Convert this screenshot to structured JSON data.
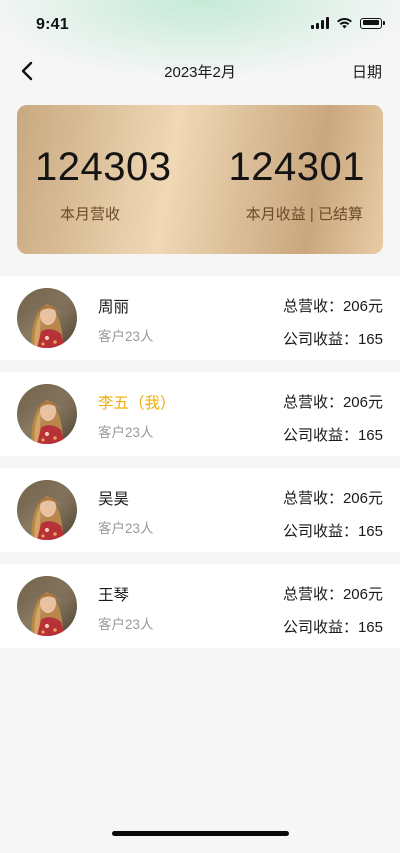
{
  "status_bar": {
    "time": "9:41",
    "icons": [
      "signal-icon",
      "wifi-icon",
      "battery-icon"
    ]
  },
  "nav": {
    "back_icon": "chevron-left-icon",
    "title": "2023年2月",
    "action_label": "日期"
  },
  "summary": {
    "left_value": "124303",
    "left_label": "本月营收",
    "right_value": "124301",
    "right_label": "本月收益 | 已结算"
  },
  "members": [
    {
      "name": "周丽",
      "customers": "客户23人",
      "revenue": "总营收：206元",
      "income": "公司收益：165",
      "is_me": false
    },
    {
      "name": "李五（我）",
      "customers": "客户23人",
      "revenue": "总营收：206元",
      "income": "公司收益：165",
      "is_me": true
    },
    {
      "name": "吴昊",
      "customers": "客户23人",
      "revenue": "总营收：206元",
      "income": "公司收益：165",
      "is_me": false
    },
    {
      "name": "王琴",
      "customers": "客户23人",
      "revenue": "总营收：206元",
      "income": "公司收益：165",
      "is_me": false
    }
  ],
  "colors": {
    "accent_me": "#f0ad0e",
    "card_gold": "#dcc19b",
    "label_brown": "#6b4a28"
  }
}
